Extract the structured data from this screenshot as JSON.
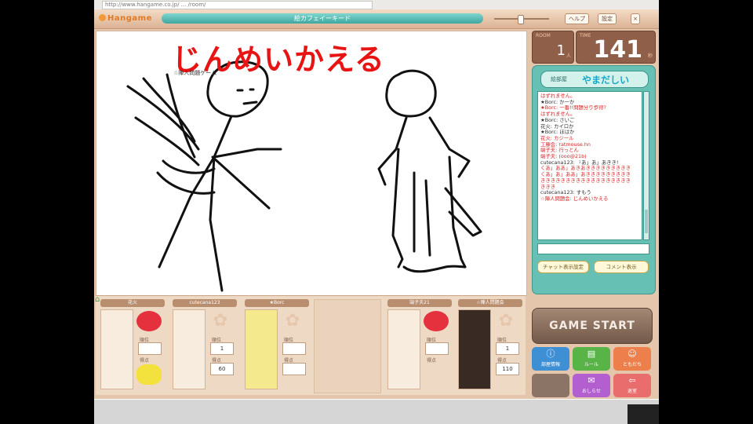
{
  "browser": {
    "url": "http://www.hangame.co.jp/ ... /room/"
  },
  "topbar": {
    "logo": "Hangame",
    "room_title": "絵カフェイーキード",
    "help_label": "ヘルプ",
    "settings_label": "設定",
    "close_label": "×"
  },
  "canvas": {
    "title_text": "じんめいかえる",
    "small_label": "☆陣人問題ゲーム"
  },
  "counters": {
    "small": {
      "label": "ROOM",
      "value": "1",
      "unit": "人"
    },
    "big": {
      "label": "TIME",
      "value": "141",
      "unit": "秒"
    }
  },
  "chat": {
    "header_label": "絵部屋",
    "header_name": "やまだしい",
    "lines": [
      {
        "text": "はずれません。",
        "color": "#d62828"
      },
      {
        "text": "★Borc: かーか",
        "color": "#333"
      },
      {
        "text": "★Borc: 一番!!問題分り歩得?",
        "color": "#d62828"
      },
      {
        "text": "はずれません。",
        "color": "#d62828"
      },
      {
        "text": "★Borc: さいご",
        "color": "#333"
      },
      {
        "text": "花火: カイロか",
        "color": "#333"
      },
      {
        "text": "★Borc: ほはか",
        "color": "#333"
      },
      {
        "text": "花火: カジール",
        "color": "#d62828"
      },
      {
        "text": "工藤会: ratmouse.hn",
        "color": "#d62828"
      },
      {
        "text": "端子夫: 行っとん",
        "color": "#d62828"
      },
      {
        "text": "端子夫: (ooo@21b)",
        "color": "#d62828"
      },
      {
        "text": "cutecana123: 「あ」あ」あきき!",
        "color": "#333"
      },
      {
        "text": "くあ」ああ」あきあききききききききき",
        "color": "#d62828"
      },
      {
        "text": "くあ」あ」ああ」あききききききききき",
        "color": "#d62828"
      },
      {
        "text": "きききききききききききききききききき",
        "color": "#d62828"
      },
      {
        "text": "ききき",
        "color": "#d62828"
      },
      {
        "text": "cutecana123: すもう",
        "color": "#333"
      },
      {
        "text": "☆陣人問題会: じんめいかえる",
        "color": "#d62828"
      }
    ],
    "settings_button": "チャット表示設定",
    "comment_button": "コメント表示"
  },
  "players": [
    {
      "name": "花火",
      "stat1_label": "順位",
      "stat1": "",
      "stat2_label": "得点",
      "stat2": ""
    },
    {
      "name": "cutecana123",
      "stat1_label": "順位",
      "stat1": "1",
      "stat2_label": "得点",
      "stat2": "60"
    },
    {
      "name": "★Borc",
      "stat1_label": "順位",
      "stat1": "",
      "stat2_label": "得点",
      "stat2": ""
    },
    {
      "name": "端子夫21",
      "stat1_label": "順位",
      "stat1": "",
      "stat2_label": "得点",
      "stat2": ""
    },
    {
      "name": "☆陣人問題会",
      "stat1_label": "順位",
      "stat1": "1",
      "stat2_label": "得点",
      "stat2": "110"
    }
  ],
  "buttons": {
    "start": "GAME START",
    "b1": "部屋情報",
    "b2": "ルール",
    "b3": "ともだち",
    "b4": "",
    "b5": "おしらせ",
    "b6": "退室"
  },
  "colors": {
    "title_red": "#e81414",
    "chat_teal": "#67c0b4",
    "panel_brown": "#8f5f49"
  }
}
